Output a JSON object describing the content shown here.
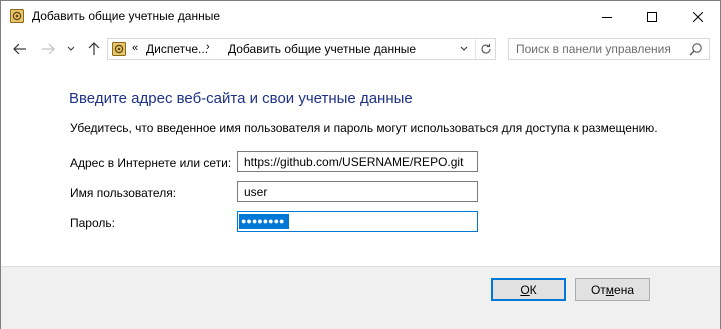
{
  "window": {
    "title": "Добавить общие учетные данные"
  },
  "address_bar": {
    "chevron": "«",
    "crumbs": [
      "Диспетче...",
      "Добавить общие учетные данные"
    ],
    "separator": "›"
  },
  "search": {
    "placeholder": "Поиск в панели управления"
  },
  "content": {
    "heading": "Введите адрес веб-сайта и свои учетные данные",
    "subtext": "Убедитесь, что введенное имя пользователя и пароль могут использоваться для доступа к размещению.",
    "address_label": "Адрес в Интернете или сети:",
    "address_value": "https://github.com/USERNAME/REPO.git",
    "username_label": "Имя пользователя:",
    "username_value": "user",
    "password_label": "Пароль:",
    "password_mask": "●●●●●●●●"
  },
  "buttons": {
    "ok": {
      "mnemonic": "О",
      "rest": "К"
    },
    "cancel": {
      "before": "От",
      "mnemonic": "м",
      "after": "ена"
    }
  },
  "colors": {
    "heading": "#1e3287",
    "accent": "#0078d7",
    "footer_bg": "#f0f0f0"
  },
  "icons": [
    "credential-manager-icon",
    "minimize-icon",
    "maximize-icon",
    "close-icon",
    "back-arrow-icon",
    "forward-arrow-icon",
    "recent-locations-icon",
    "up-arrow-icon",
    "dropdown-icon",
    "refresh-icon",
    "search-icon"
  ]
}
